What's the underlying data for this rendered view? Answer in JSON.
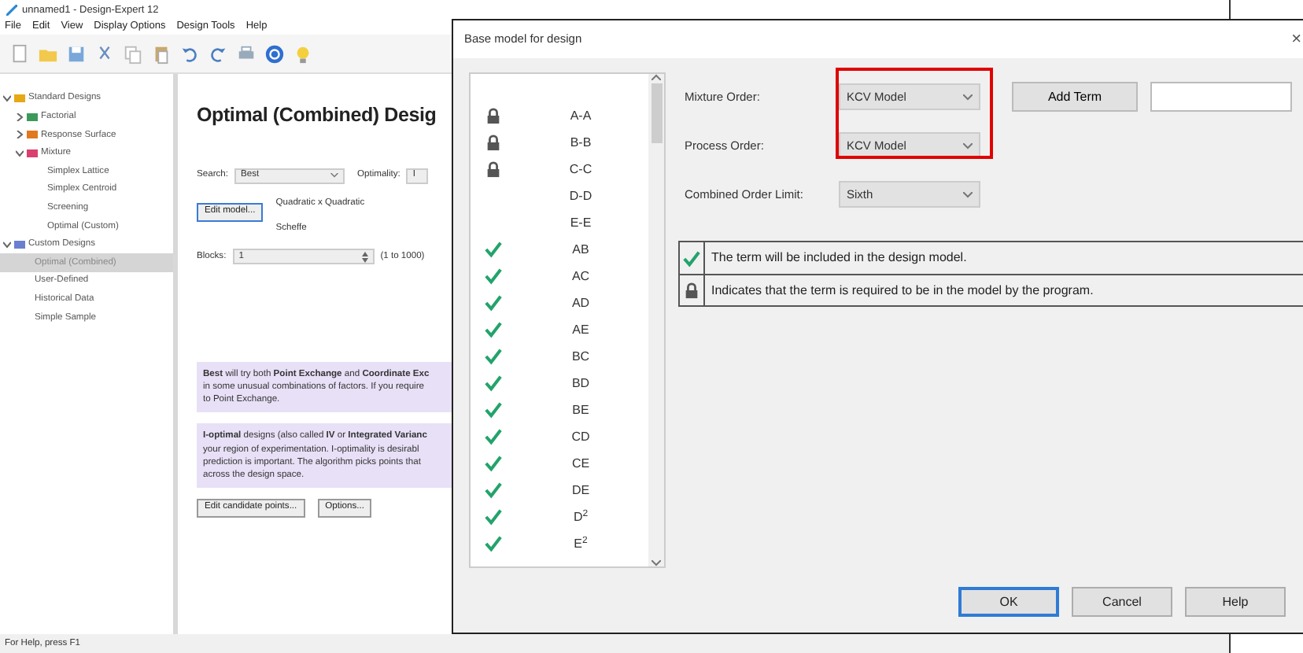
{
  "app": {
    "title": "unnamed1 - Design-Expert 12",
    "menu": [
      "File",
      "Edit",
      "View",
      "Display Options",
      "Design Tools",
      "Help"
    ],
    "tree": [
      {
        "label": "Standard Designs",
        "expanded": true,
        "selected": false,
        "children": [
          {
            "label": "Factorial",
            "expanded": false,
            "selected": false
          },
          {
            "label": "Response Surface",
            "expanded": false,
            "selected": false
          },
          {
            "label": "Mixture",
            "expanded": true,
            "selected": false,
            "children": [
              {
                "label": "Simplex Lattice",
                "selected": false
              },
              {
                "label": "Simplex Centroid",
                "selected": false
              },
              {
                "label": "Screening",
                "selected": false
              },
              {
                "label": "Optimal (Custom)",
                "selected": false
              }
            ]
          }
        ]
      },
      {
        "label": "Custom Designs",
        "expanded": true,
        "selected": false,
        "children": [
          {
            "label": "Optimal (Combined)",
            "selected": true
          },
          {
            "label": "User-Defined",
            "selected": false
          },
          {
            "label": "Historical Data",
            "selected": false
          },
          {
            "label": "Simple Sample",
            "selected": false
          }
        ]
      }
    ],
    "heading": "Optimal (Combined) Desig",
    "search_label": "Search:",
    "search_value": "Best",
    "optimality_label": "Optimality:",
    "optimality_value": "I",
    "edit_model_button": "Edit model...",
    "model_lines": [
      "Quadratic x Quadratic",
      "Scheffe"
    ],
    "blocks_label": "Blocks:",
    "blocks_value": "1",
    "blocks_range": "(1 to 1000)",
    "notes": [
      [
        "**Best** will try both **Point Exchange** and **Coordinate Exc**",
        "in some unusual combinations of factors. If you require",
        "to Point Exchange."
      ],
      [
        "**I-optimal** designs (also called **IV** or **Integrated Varianc**",
        "your region of experimentation. I-optimality is desirabl",
        "prediction is important. The algorithm picks points that",
        "across the design space."
      ]
    ],
    "buttons": [
      "Edit candidate points...",
      "Options..."
    ],
    "status_bar": "For Help, press F1"
  },
  "dialog": {
    "title": "Base model for design",
    "close": "×",
    "terms": [
      {
        "term": "A-A",
        "kind": "required"
      },
      {
        "term": "B-B",
        "kind": "required"
      },
      {
        "term": "C-C",
        "kind": "required"
      },
      {
        "term": "D-D",
        "kind": "excluded"
      },
      {
        "term": "E-E",
        "kind": "excluded"
      },
      {
        "term": "AB",
        "kind": "included"
      },
      {
        "term": "AC",
        "kind": "included"
      },
      {
        "term": "AD",
        "kind": "included"
      },
      {
        "term": "AE",
        "kind": "included"
      },
      {
        "term": "BC",
        "kind": "included"
      },
      {
        "term": "BD",
        "kind": "included"
      },
      {
        "term": "BE",
        "kind": "included"
      },
      {
        "term": "CD",
        "kind": "included"
      },
      {
        "term": "CE",
        "kind": "included"
      },
      {
        "term": "DE",
        "kind": "included"
      },
      {
        "term": "D$^{2}$",
        "kind": "included"
      },
      {
        "term": "E$^{2}$",
        "kind": "included"
      }
    ],
    "fields": [
      {
        "label": "Mixture Order:",
        "value": "KCV Model",
        "highlighted": true
      },
      {
        "label": "Process Order:",
        "value": "KCV Model",
        "highlighted": true
      },
      {
        "label": "Combined Order Limit:",
        "value": "Sixth",
        "highlighted": false
      }
    ],
    "add_term_button": "Add Term",
    "legend": [
      {
        "kind": "included",
        "text": "The term will be included in the design model."
      },
      {
        "kind": "required",
        "text": "Indicates that the term is required to be in the model by the program."
      }
    ],
    "buttons": [
      {
        "label": "OK",
        "default": true
      },
      {
        "label": "Cancel",
        "default": false
      },
      {
        "label": "Help",
        "default": false
      }
    ]
  }
}
